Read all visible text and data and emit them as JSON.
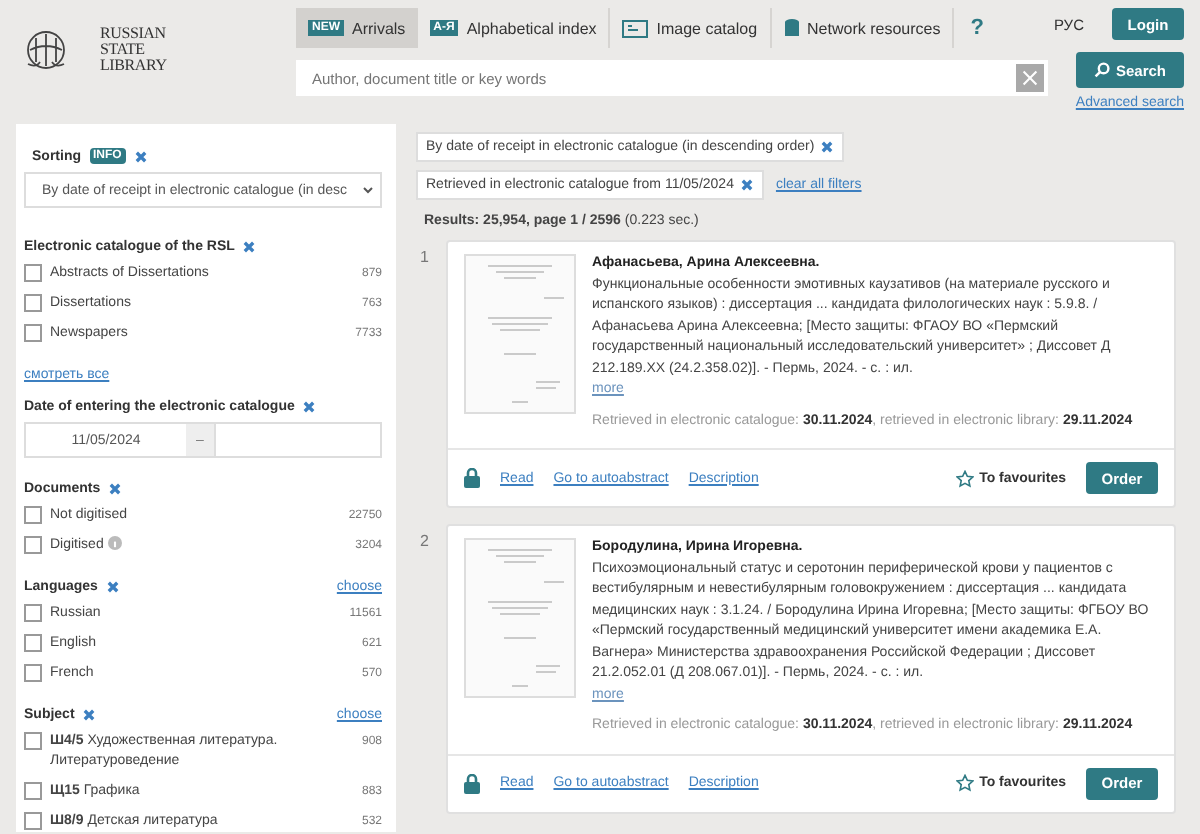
{
  "logo": {
    "lines": [
      "RUSSIAN",
      "STATE",
      "LIBRARY"
    ]
  },
  "nav": [
    {
      "kind": "badge",
      "badge": "NEW",
      "label": "Arrivals",
      "selected": true
    },
    {
      "kind": "badge",
      "badge": "А-Я",
      "label": "Alphabetical index",
      "selected": false
    },
    {
      "kind": "image",
      "label": "Image catalog",
      "selected": false
    },
    {
      "kind": "network",
      "label": "Network resources",
      "selected": false
    },
    {
      "kind": "help",
      "label": "?",
      "selected": false
    }
  ],
  "language": "РУС",
  "login": "Login",
  "search": {
    "placeholder": "Author, document title or key words",
    "button": "Search",
    "advanced": "Advanced search"
  },
  "sidebar": {
    "sorting": {
      "title": "Sorting",
      "badge": "INFO",
      "value": "By date of receipt in electronic catalogue (in desc"
    },
    "sections": [
      {
        "kind": "checklist",
        "title": "Electronic catalogue of the RSL",
        "more": "смотреть все",
        "items": [
          {
            "label": "Abstracts of Dissertations",
            "count": "879",
            "checked": false
          },
          {
            "label": "Dissertations",
            "count": "763",
            "checked": false
          },
          {
            "label": "Newspapers",
            "count": "7733",
            "checked": false
          }
        ]
      },
      {
        "kind": "date",
        "title": "Date of entering the electronic catalogue",
        "from": "11/05/2024",
        "separator": "–"
      },
      {
        "kind": "checklist",
        "title": "Documents",
        "items": [
          {
            "label": "Not digitised",
            "count": "22750",
            "checked": false
          },
          {
            "label": "Digitised",
            "count": "3204",
            "checked": false,
            "info": true
          }
        ]
      },
      {
        "kind": "checklist",
        "title": "Languages",
        "choose": "choose",
        "items": [
          {
            "label": "Russian",
            "count": "11561",
            "checked": false
          },
          {
            "label": "English",
            "count": "621",
            "checked": false
          },
          {
            "label": "French",
            "count": "570",
            "checked": false
          }
        ]
      },
      {
        "kind": "checklist",
        "title": "Subject",
        "choose": "choose",
        "items": [
          {
            "label": "**Ш4/5** Художественная литература. Литературоведение",
            "count": "908",
            "checked": false
          },
          {
            "label": "**Щ15** Графика",
            "count": "883",
            "checked": false
          },
          {
            "label": "**Ш8/9** Детская литература",
            "count": "532",
            "checked": false
          }
        ]
      }
    ]
  },
  "filters": [
    "By date of receipt in electronic catalogue (in descending order)",
    "Retrieved in electronic catalogue from 11/05/2024"
  ],
  "clear_filters": "clear all filters",
  "summary": "**Results: 25,954, page 1 / 2596** (0.223 sec.)",
  "results": [
    {
      "number": "1",
      "author": "Афанасьева, Арина Алексеевна.",
      "description": "Функциональные особенности эмотивных каузативов (на материале русского и испанского языков) : диссертация ... кандидата филологических наук : 5.9.8. / Афанасьева Арина Алексеевна; [Место защиты: ФГАОУ ВО «Пермский государственный национальный исследовательский университет» ; Диссовет Д 212.189.XX (24.2.358.02)]. - Пермь, 2024. - с. : ил.",
      "more": "more",
      "retrieved": "Retrieved in electronic catalogue: **30.11.2024**, retrieved in electronic library: **29.11.2024**",
      "links": [
        "Read",
        "Go to autoabstract",
        "Description"
      ],
      "favourites": "To favourites",
      "order": "Order"
    },
    {
      "number": "2",
      "author": "Бородулина, Ирина Игоревна.",
      "description": "Психоэмоциональный статус и серотонин периферической крови у пациентов с вестибулярным и невестибулярным головокружением : диссертация ... кандидата медицинских наук : 3.1.24. / Бородулина Ирина Игоревна; [Место защиты: ФГБОУ ВО «Пермский государственный медицинский университет имени академика Е.А. Вагнера» Министерства здравоохранения Российской Федерации ; Диссовет 21.2.052.01 (Д 208.067.01)]. - Пермь, 2024. - с. : ил.",
      "more": "more",
      "retrieved": "Retrieved in electronic catalogue: **30.11.2024**, retrieved in electronic library: **29.11.2024**",
      "links": [
        "Read",
        "Go to autoabstract",
        "Description"
      ],
      "favourites": "To favourites",
      "order": "Order"
    }
  ]
}
